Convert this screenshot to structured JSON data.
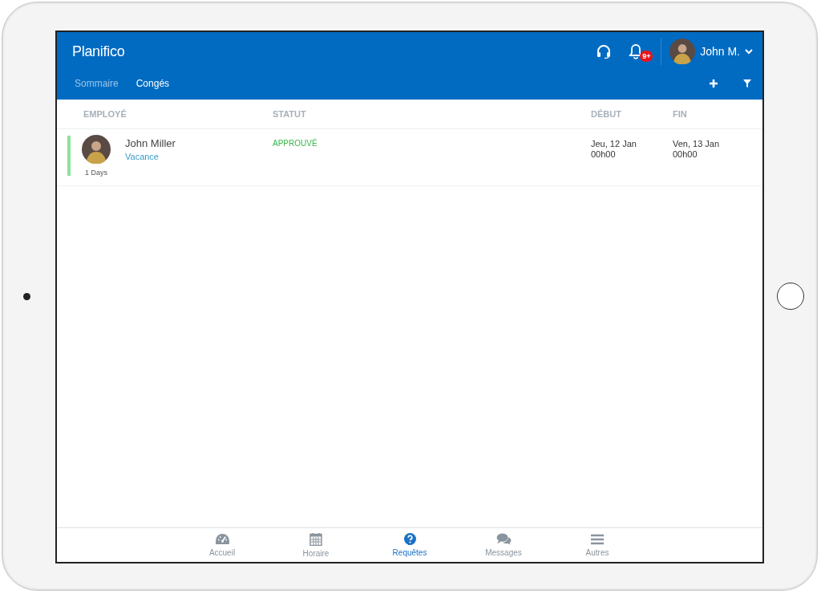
{
  "app": {
    "logo": "Planifico",
    "notification_badge": "9+",
    "user_name": "John M."
  },
  "tabs": [
    {
      "label": "Sommaire",
      "selected": false
    },
    {
      "label": "Congés",
      "selected": true
    }
  ],
  "table": {
    "columns": [
      "EMPLOYÉ",
      "STATUT",
      "DÉBUT",
      "FIN"
    ],
    "rows": [
      {
        "name": "John Miller",
        "type": "Vacance",
        "duration": "1 Days",
        "status": "APPROUVÉ",
        "start_date": "Jeu, 12 Jan",
        "start_time": "00h00",
        "end_date": "Ven, 13 Jan",
        "end_time": "00h00"
      }
    ]
  },
  "nav": [
    {
      "label": "Accueil",
      "kind": "gauge",
      "selected": false
    },
    {
      "label": "Horaire",
      "kind": "calendar",
      "selected": false
    },
    {
      "label": "Requêtes",
      "kind": "question",
      "selected": true
    },
    {
      "label": "Messages",
      "kind": "chat",
      "selected": false
    },
    {
      "label": "Autres",
      "kind": "menu",
      "selected": false
    }
  ]
}
